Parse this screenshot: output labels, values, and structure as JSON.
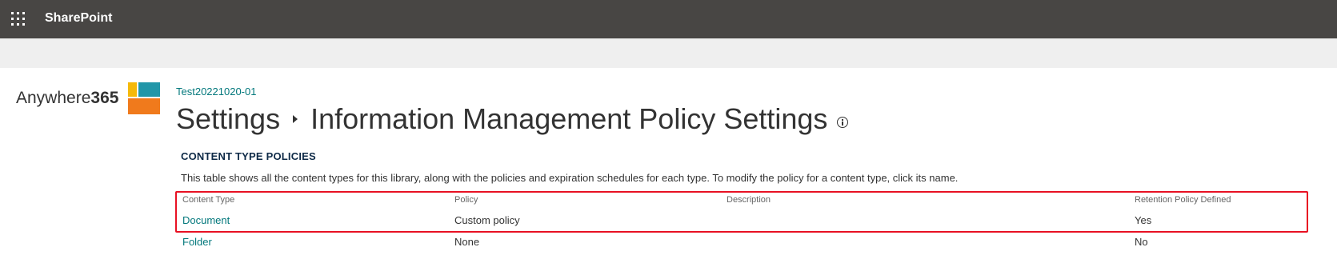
{
  "suite_bar": {
    "app_launcher_icon": "waffle-icon",
    "app_name": "SharePoint",
    "background": "#484644"
  },
  "logo": {
    "text_regular": "Anywhere",
    "text_bold": "365",
    "colors": [
      "#f5b90a",
      "#2196a8",
      "#f07a1c"
    ]
  },
  "breadcrumb": {
    "site_link": "Test20221020-01"
  },
  "page_title": {
    "parent": "Settings",
    "current": "Information Management Policy Settings",
    "info_icon": "info-icon"
  },
  "section": {
    "heading": "CONTENT TYPE POLICIES",
    "description": "This table shows all the content types for this library, along with the policies and expiration schedules for each type. To modify the policy for a content type, click its name."
  },
  "table": {
    "columns": [
      "Content Type",
      "Policy",
      "Description",
      "Retention Policy Defined"
    ],
    "rows": [
      {
        "content_type": "Document",
        "policy": "Custom policy",
        "description": "",
        "retention": "Yes"
      },
      {
        "content_type": "Folder",
        "policy": "None",
        "description": "",
        "retention": "No"
      }
    ]
  },
  "accent_colors": {
    "link": "#03787c",
    "highlight": "#e81123"
  }
}
